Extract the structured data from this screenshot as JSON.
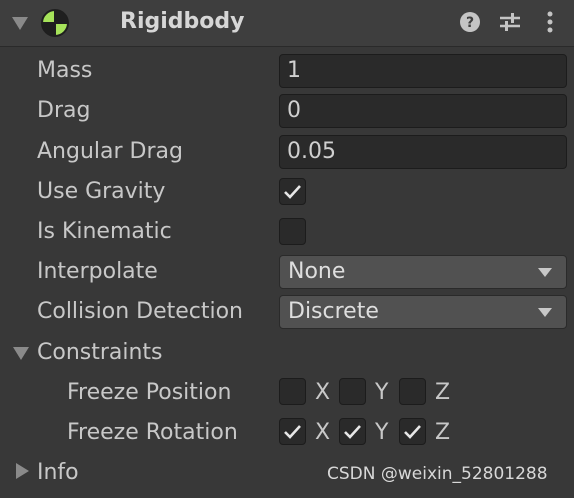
{
  "header": {
    "title": "Rigidbody",
    "icons": [
      "fold-arrow-icon",
      "rigidbody-icon",
      "help-icon",
      "preset-sliders-icon",
      "more-options-icon"
    ]
  },
  "properties": {
    "mass": {
      "label": "Mass",
      "value": "1"
    },
    "drag": {
      "label": "Drag",
      "value": "0"
    },
    "angular_drag": {
      "label": "Angular Drag",
      "value": "0.05"
    },
    "use_gravity": {
      "label": "Use Gravity",
      "checked": true
    },
    "is_kinematic": {
      "label": "Is Kinematic",
      "checked": false
    },
    "interpolate": {
      "label": "Interpolate",
      "value": "None"
    },
    "collision_detection": {
      "label": "Collision Detection",
      "value": "Discrete"
    }
  },
  "constraints": {
    "label": "Constraints",
    "freeze_position": {
      "label": "Freeze Position",
      "x": false,
      "y": false,
      "z": false
    },
    "freeze_rotation": {
      "label": "Freeze Rotation",
      "x": true,
      "y": true,
      "z": true
    },
    "axes": {
      "x": "X",
      "y": "Y",
      "z": "Z"
    }
  },
  "info": {
    "label": "Info"
  },
  "watermark": "CSDN @weixin_52801288",
  "colors": {
    "background": "#383838",
    "field": "#2a2a2a",
    "dropdown": "#515151",
    "text": "#c8c8c8",
    "rigidbody_icon": "#a6e35a"
  }
}
